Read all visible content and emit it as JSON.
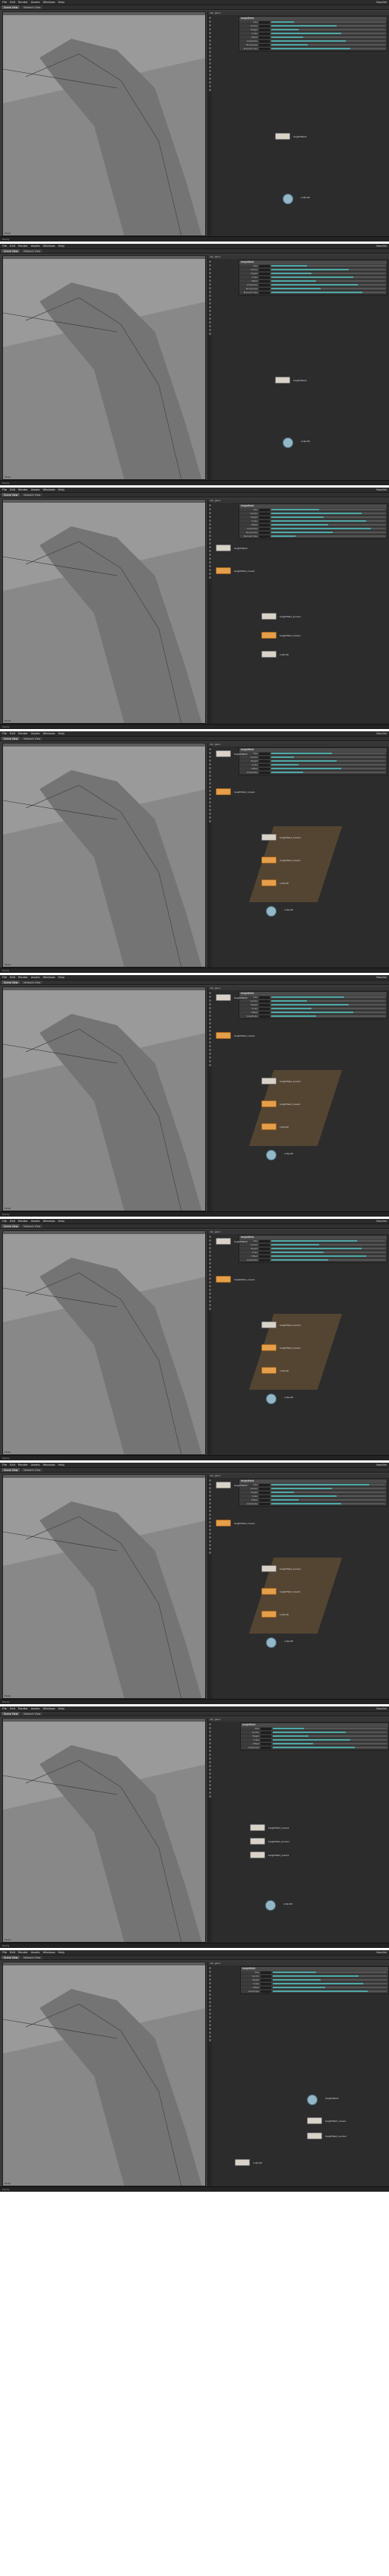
{
  "strips": [
    {
      "status": "Ready"
    },
    {
      "status": "Ready"
    },
    {
      "status": "Ready"
    },
    {
      "status": "Ready"
    },
    {
      "status": "Ready"
    },
    {
      "status": "Ready"
    },
    {
      "status": "Ready"
    },
    {
      "status": "Ready"
    },
    {
      "status": "Ready"
    }
  ],
  "app": {
    "menu": [
      "File",
      "Edit",
      "Render",
      "Assets",
      "Windows",
      "Help"
    ],
    "title": "Houdini",
    "tabs": [
      "Scene View",
      "Network View"
    ],
    "right_tabs": [
      "obj",
      "geo1"
    ]
  },
  "viewport": {
    "label": "Persp",
    "colors": {
      "sky": "#9a9a9a",
      "ground": "#888888",
      "mesh": "#747474"
    }
  },
  "params": {
    "title": "heightfield",
    "rows": [
      "Size",
      "Center",
      "Height",
      "Scale",
      "Offset",
      "Amplitude",
      "Roughness",
      "Element Size"
    ]
  },
  "nodes": {
    "n1": "heightfield1",
    "n2": "heightfield_noise1",
    "n3": "heightfield_erode1",
    "n4": "heightfield_mask1",
    "n5": "output0"
  },
  "accent": "#e59f4a"
}
